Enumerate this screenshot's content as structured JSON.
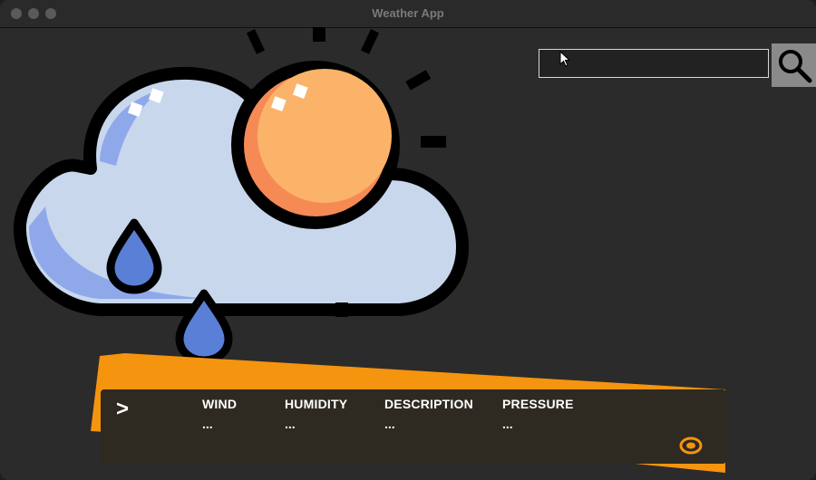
{
  "window": {
    "title": "Weather App"
  },
  "search": {
    "value": "",
    "placeholder": ""
  },
  "weather_icon": {
    "name": "cloud-sun-rain-icon"
  },
  "panel": {
    "toggle_label": ">",
    "metrics": [
      {
        "label": "WIND",
        "value": "..."
      },
      {
        "label": "HUMIDITY",
        "value": "..."
      },
      {
        "label": "DESCRIPTION",
        "value": "..."
      },
      {
        "label": "PRESSURE",
        "value": "..."
      }
    ]
  },
  "colors": {
    "background": "#2b2b2b",
    "panel": "#2e2a21",
    "accent_orange": "#f5940f",
    "cloud_fill": "#c8d7ec",
    "cloud_shade": "#8ea8ea",
    "sun_fill": "#fbb36a",
    "sun_shade": "#f58a55",
    "rain": "#5a7fd6"
  }
}
